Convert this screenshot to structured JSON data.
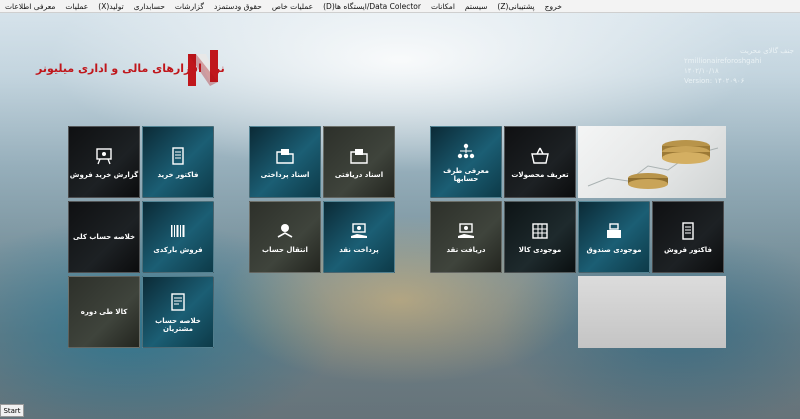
{
  "menu": [
    "معرفی اطلاعات",
    "عملیات",
    "تولید(X)",
    "حسابداری",
    "گزارشات",
    "حقوق ودستمزد",
    "عملیات خاص",
    "Data Colector/ایستگاه ها(D)",
    "امکانات",
    "سیستم",
    "پشتیبانی(Z)",
    "خروج"
  ],
  "logo_text": "نرم افزارهای مالی و اداری میلیونر",
  "info": {
    "line1": "جنف گالای محریت",
    "line2": "۲millionaireforoshgahi",
    "line3": "۱۴۰۲/۱۰/۱۸",
    "line4": "Version: ۱۴۰۲۰۹۰۶"
  },
  "tiles": {
    "gozaresh_kharid_forosh": "گزارش خرید فروش",
    "factor_kharid": "فاکتور خرید",
    "kholase_hesab_koli": "خلاصه حساب کلی",
    "forosh_barcodi": "فروش بارکدی",
    "kala_tey_doreh": "کالا طی دوره",
    "kholase_hesab_moshtarian": "خلاصه حساب مشتریان",
    "asnad_pardakhti": "اسناد پرداختی",
    "asnad_daryafti": "اسناد دریافتی",
    "enteghal_hesab": "انتقال حساب",
    "pardakht_naghd": "پرداخت نقد",
    "moarefi_taraf_hesab": "معرفی طرف حسابها",
    "tarif_mahsolat": "تعریف محصولات",
    "daryaft_naghd": "دریافت نقد",
    "mojodi_kala": "موجودی کالا",
    "mojodi_sandogh": "موجودی صندوق",
    "factor_forosh": "فاکتور فروش"
  },
  "start_label": "Start",
  "colors": {
    "brand": "#c0161b",
    "tile_blue": "#1b5e74",
    "tile_dark": "#1d2124"
  }
}
